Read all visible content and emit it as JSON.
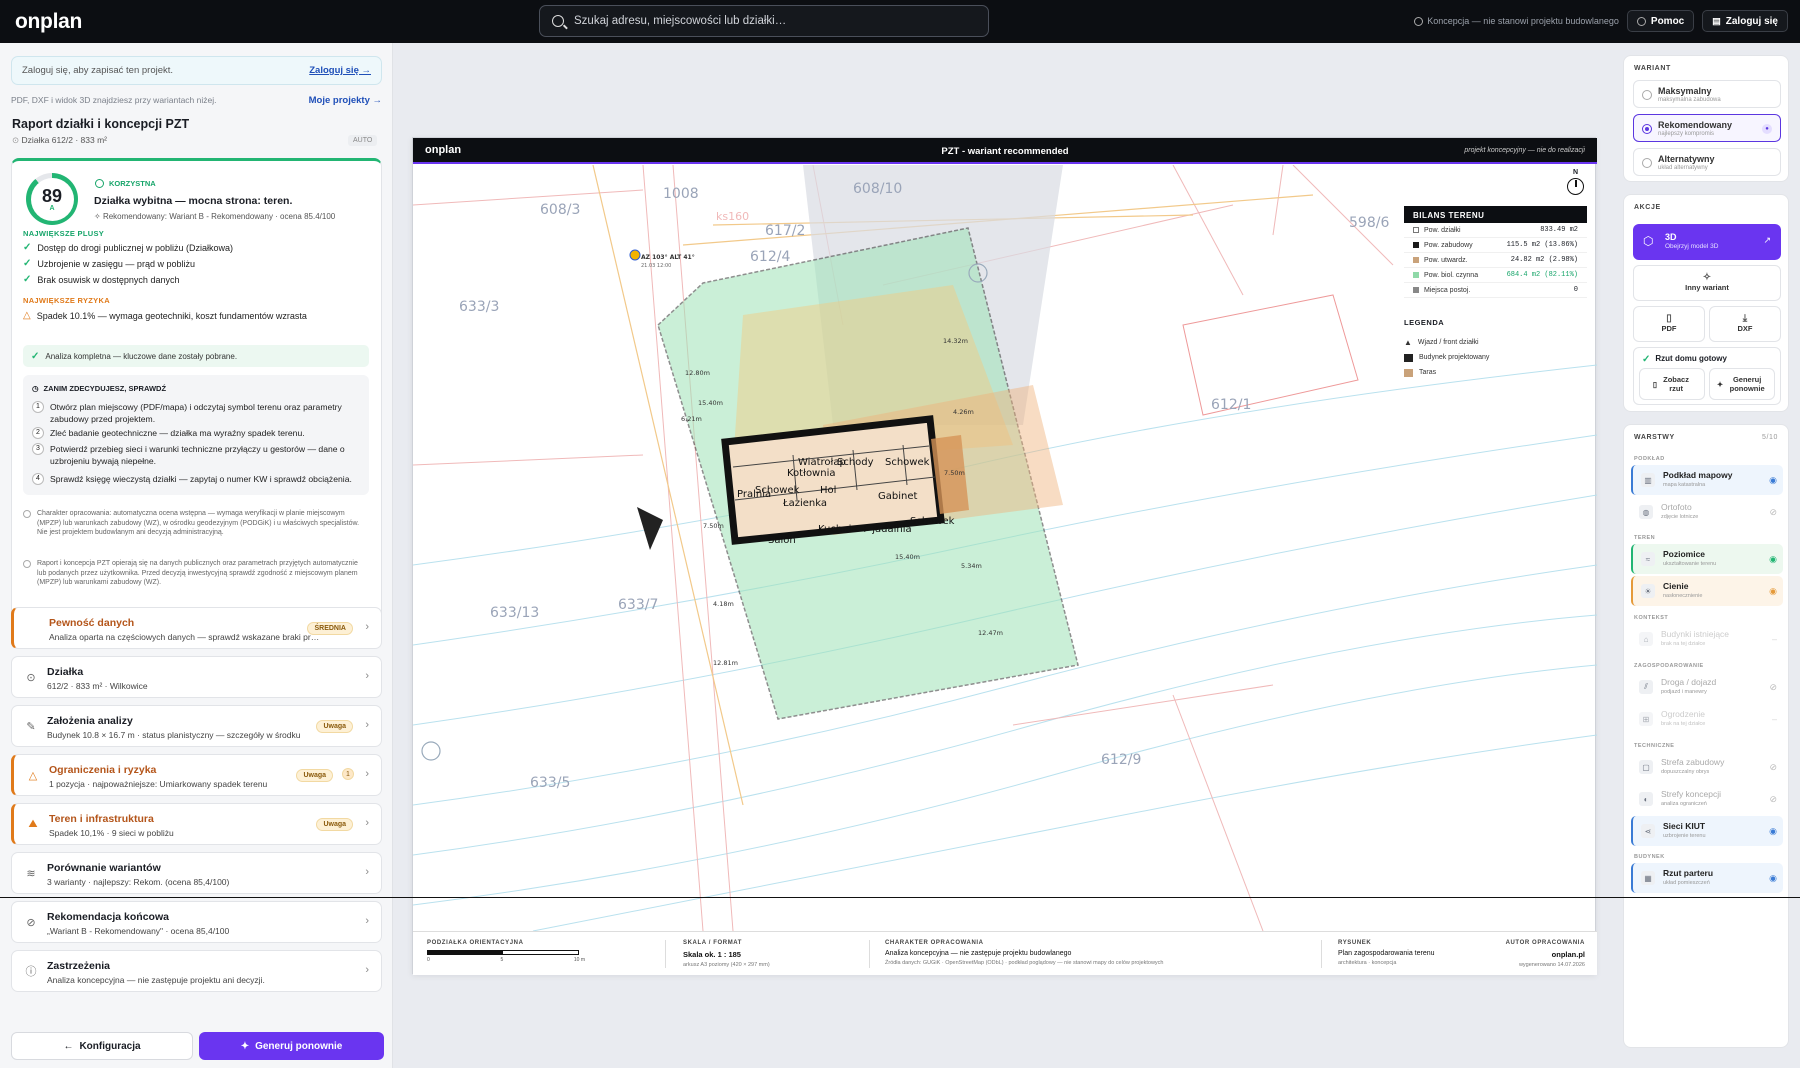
{
  "app": {
    "logo": "onplan",
    "search_placeholder": "Szukaj adresu, miejscowości lub działki…",
    "note": "Koncepcja — nie stanowi projektu budowlanego",
    "help": "Pomoc",
    "login": "Zaloguj się"
  },
  "left": {
    "login_bar": "Zaloguj się, aby zapisać ten projekt.",
    "login_link": "Zaloguj się →",
    "sub_note": "PDF, DXF i widok 3D znajdziesz przy wariantach niżej.",
    "my_projects": "Moje projekty →",
    "report_title": "Raport działki i koncepcji PZT",
    "report_sub": "Działka 612/2 · 833 m²",
    "auto": "AUTO",
    "score": {
      "value": "89",
      "fraction": 0.89,
      "grade": "A",
      "label": "KORZYSTNA",
      "title": "Działka wybitna — mocna strona: teren.",
      "sub": "Rekomendowany: Wariant B - Rekomendowany · ocena 85.4/100"
    },
    "plus_header": "NAJWIĘKSZE PLUSY",
    "plus": [
      "Dostęp do drogi publicznej w pobliżu (Działkowa)",
      "Uzbrojenie w zasięgu — prąd w pobliżu",
      "Brak osuwisk w dostępnych danych"
    ],
    "risk_header": "NAJWIĘKSZE RYZYKA",
    "risks": [
      "Spadek 10.1% — wymaga geotechniki, koszt fundamentów wzrasta"
    ],
    "complete_note": "Analiza kompletna — kluczowe dane zostały pobrane.",
    "check_header": "ZANIM ZDECYDUJESZ, SPRAWDŹ",
    "steps": [
      {
        "n": "1",
        "text": "Otwórz plan miejscowy (PDF/mapa) i odczytaj symbol terenu oraz parametry zabudowy przed projektem."
      },
      {
        "n": "2",
        "text": "Zleć badanie geotechniczne — działka ma wyraźny spadek terenu."
      },
      {
        "n": "3",
        "text": "Potwierdź przebieg sieci i warunki techniczne przyłączy u gestorów — dane o uzbrojeniu bywają niepełne."
      },
      {
        "n": "4",
        "text": "Sprawdź księgę wieczystą działki — zapytaj o numer KW i sprawdź obciążenia."
      }
    ],
    "disclaimers": [
      "Charakter opracowania: automatyczna ocena wstępna — wymaga weryfikacji w planie miejscowym (MPZP) lub warunkach zabudowy (WZ), w ośrodku geodezyjnym (PODGiK) i u właściwych specjalistów. Nie jest projektem budowlanym ani decyzją administracyjną.",
      "Raport i koncepcja PZT opierają się na danych publicznych oraz parametrach przyjętych automatycznie lub podanych przez użytkownika. Przed decyzją inwestycyjną sprawdź zgodność z miejscowym planem (MPZP) lub warunkami zabudowy (WZ)."
    ],
    "cards": [
      {
        "title": "Pewność danych",
        "sub": "Analiza oparta na częściowych danych — sprawdź wskazane braki pr…",
        "badge": "ŚREDNIA"
      },
      {
        "title": "Działka",
        "sub": "612/2 · 833 m² · Wilkowice"
      },
      {
        "title": "Założenia analizy",
        "sub": "Budynek 10.8 × 16.7 m · status planistyczny — szczegóły w środku",
        "badge": "Uwaga"
      },
      {
        "title": "Ograniczenia i ryzyka",
        "sub": "1 pozycja · najpoważniejsze: Umiarkowany spadek terenu",
        "badge": "Uwaga",
        "count": "1"
      },
      {
        "title": "Teren i infrastruktura",
        "sub": "Spadek 10,1% · 9 sieci w pobliżu",
        "badge": "Uwaga"
      },
      {
        "title": "Porównanie wariantów",
        "sub": "3 warianty · najlepszy: Rekom. (ocena 85,4/100)"
      },
      {
        "title": "Rekomendacja końcowa",
        "sub": "„Wariant B - Rekomendowany\" · ocena 85,4/100"
      },
      {
        "title": "Zastrzeżenia",
        "sub": "Analiza koncepcyjna — nie zastępuje projektu ani decyzji."
      }
    ],
    "btn_konf": "Konfiguracja",
    "btn_gen": "Generuj ponownie"
  },
  "sheet": {
    "logo": "onplan",
    "title": "PZT - wariant recommended",
    "tag": "projekt koncepcyjny — nie do realizacji",
    "north": "N",
    "bilans_title": "BILANS TERENU",
    "bilans": [
      {
        "k": "Pow. działki",
        "v": "833.49 m2",
        "color": "#ffffff"
      },
      {
        "k": "Pow. zabudowy",
        "v": "115.5 m2 (13.86%)",
        "color": "#1a1a1a"
      },
      {
        "k": "Pow. utwardz.",
        "v": "24.82 m2 (2.98%)",
        "color": "#c9a27a"
      },
      {
        "k": "Pow. biol. czynna",
        "v": "684.4 m2 (82.11%)",
        "color": "#8fd9a8"
      },
      {
        "k": "Miejsca postoj.",
        "v": "0",
        "color": "#888888"
      }
    ],
    "legend_title": "LEGENDA",
    "legend": [
      "Wjazd / front działki",
      "Budynek projektowany",
      "Taras"
    ],
    "parcels": [
      "1008",
      "608/10",
      "608/3",
      "612/4",
      "617/2",
      "633/3",
      "598/6",
      "612/1",
      "633/13",
      "633/7",
      "612/9",
      "633/5"
    ],
    "rooms": [
      "Wiatrołap",
      "Schody",
      "Schowek",
      "Kotłownia",
      "Pralnia",
      "Schowek",
      "Hol",
      "Łazienka",
      "Gabinet",
      "Schowek",
      "Salon",
      "Kuchnia + jadalnia"
    ],
    "dims": [
      "15.40m",
      "15.40m",
      "7.50m",
      "7.50m",
      "12.80m",
      "14.32m",
      "6.21m",
      "4.26m",
      "5.34m",
      "4.18m",
      "12.47m",
      "12.81m"
    ],
    "az_label": "AZ 103° ALT 41°",
    "az_date": "21.03 12:00",
    "ks": "ks160",
    "foot": {
      "scale_h": "PODZIAŁKA ORIENTACYJNA",
      "scale_ticks": [
        "0",
        "5",
        "10 m"
      ],
      "format_h": "SKALA / FORMAT",
      "format_v": "Skala ok. 1 : 185",
      "format_s": "arkusz A3 poziomy (420 × 297 mm)",
      "char_h": "CHARAKTER OPRACOWANIA",
      "char_v": "Analiza koncepcyjna — nie zastępuje projektu budowlanego",
      "char_s": "Źródła danych: GUGiK · OpenStreetMap (ODbL) · podkład poglądowy — nie stanowi mapy do celów projektowych",
      "rys_h": "RYSUNEK",
      "rys_v": "Plan zagospodarowania terenu",
      "rys_s": "architektura · koncepcja",
      "aut_h": "AUTOR OPRACOWANIA",
      "aut_v": "onplan.pl",
      "aut_s": "wygenerowano 14.07.2026"
    }
  },
  "right": {
    "wariant_h": "WARIANT",
    "variants": [
      {
        "t": "Maksymalny",
        "s": "maksymalna zabudowa"
      },
      {
        "t": "Rekomendowany",
        "s": "najlepszy kompromis"
      },
      {
        "t": "Alternatywny",
        "s": "układ alternatywny"
      }
    ],
    "akcje_h": "AKCJE",
    "btn3d_t": "3D",
    "btn3d_s": "Obejrzyj model 3D",
    "inny": "Inny wariant",
    "pdf": "PDF",
    "dxf": "DXF",
    "rzut_ready": "Rzut domu gotowy",
    "zobacz": "Zobacz rzut",
    "generuj": "Generuj ponownie",
    "warstwy_h": "WARSTWY",
    "warstwy_count": "5/10",
    "groups": [
      "PODKŁAD",
      "TEREN",
      "KONTEKST",
      "ZAGOSPODAROWANIE",
      "TECHNICZNE",
      "BUDYNEK"
    ],
    "layers": [
      {
        "t": "Podkład mapowy",
        "s": "mapa katastralna"
      },
      {
        "t": "Ortofoto",
        "s": "zdjęcie lotnicze"
      },
      {
        "t": "Poziomice",
        "s": "ukształtowanie terenu"
      },
      {
        "t": "Cienie",
        "s": "nasłonecznienie"
      },
      {
        "t": "Budynki istniejące",
        "s": "brak na tej działce"
      },
      {
        "t": "Droga / dojazd",
        "s": "podjazd i manewry"
      },
      {
        "t": "Ogrodzenie",
        "s": "brak na tej działce"
      },
      {
        "t": "Strefa zabudowy",
        "s": "dopuszczalny obrys"
      },
      {
        "t": "Strefy koncepcji",
        "s": "analiza ograniczeń"
      },
      {
        "t": "Sieci KIUT",
        "s": "uzbrojenie terenu"
      },
      {
        "t": "Rzut parteru",
        "s": "układ pomieszczeń"
      }
    ]
  }
}
